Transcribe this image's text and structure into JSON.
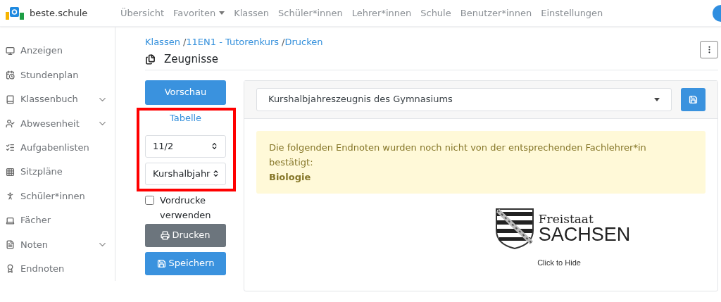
{
  "brand": {
    "name": "beste.schule"
  },
  "nav": [
    {
      "label": "Übersicht",
      "dropdown": false
    },
    {
      "label": "Favoriten",
      "dropdown": true
    },
    {
      "label": "Klassen",
      "dropdown": false
    },
    {
      "label": "Schüler*innen",
      "dropdown": false
    },
    {
      "label": "Lehrer*innen",
      "dropdown": false
    },
    {
      "label": "Schule",
      "dropdown": false
    },
    {
      "label": "Benutzer*innen",
      "dropdown": false
    },
    {
      "label": "Einstellungen",
      "dropdown": false
    }
  ],
  "sidebar": {
    "items": [
      {
        "label": "Anzeigen",
        "expandable": false
      },
      {
        "label": "Stundenplan",
        "expandable": false
      },
      {
        "label": "Klassenbuch",
        "expandable": true
      },
      {
        "label": "Abwesenheit",
        "expandable": true
      },
      {
        "label": "Aufgabenlisten",
        "expandable": false
      },
      {
        "label": "Sitzpläne",
        "expandable": false
      },
      {
        "label": "Schüler*innen",
        "expandable": false
      },
      {
        "label": "Fächer",
        "expandable": false
      },
      {
        "label": "Noten",
        "expandable": true
      },
      {
        "label": "Endnoten",
        "expandable": false
      }
    ]
  },
  "breadcrumb": [
    {
      "label": "Klassen"
    },
    {
      "separator": "/",
      "label": "11EN1 - Tutorenkurs"
    },
    {
      "separator": "/",
      "label": "Drucken"
    }
  ],
  "page_title": "Zeugnisse",
  "controls": {
    "preview_button": "Vorschau",
    "table_link": "Tabelle",
    "highlighted": true,
    "term_select": {
      "value": "11/2"
    },
    "type_select": {
      "value": "Kurshalbjahr"
    },
    "use_forms": {
      "label": "Vordrucke verwenden",
      "checked": false
    },
    "print_button": "Drucken",
    "save_button": "Speichern"
  },
  "template_select": {
    "value": "Kurshalbjahreszeugnis des Gymnasiums"
  },
  "alert": {
    "message": "Die folgenden Endnoten wurden noch nicht von der entsprechenden Fachlehrer*in bestätigt:",
    "subjects": [
      "Biologie"
    ]
  },
  "logo": {
    "line_1": "Freistaat",
    "line_2": "SACHSEN",
    "hide_label": "Click to Hide"
  }
}
